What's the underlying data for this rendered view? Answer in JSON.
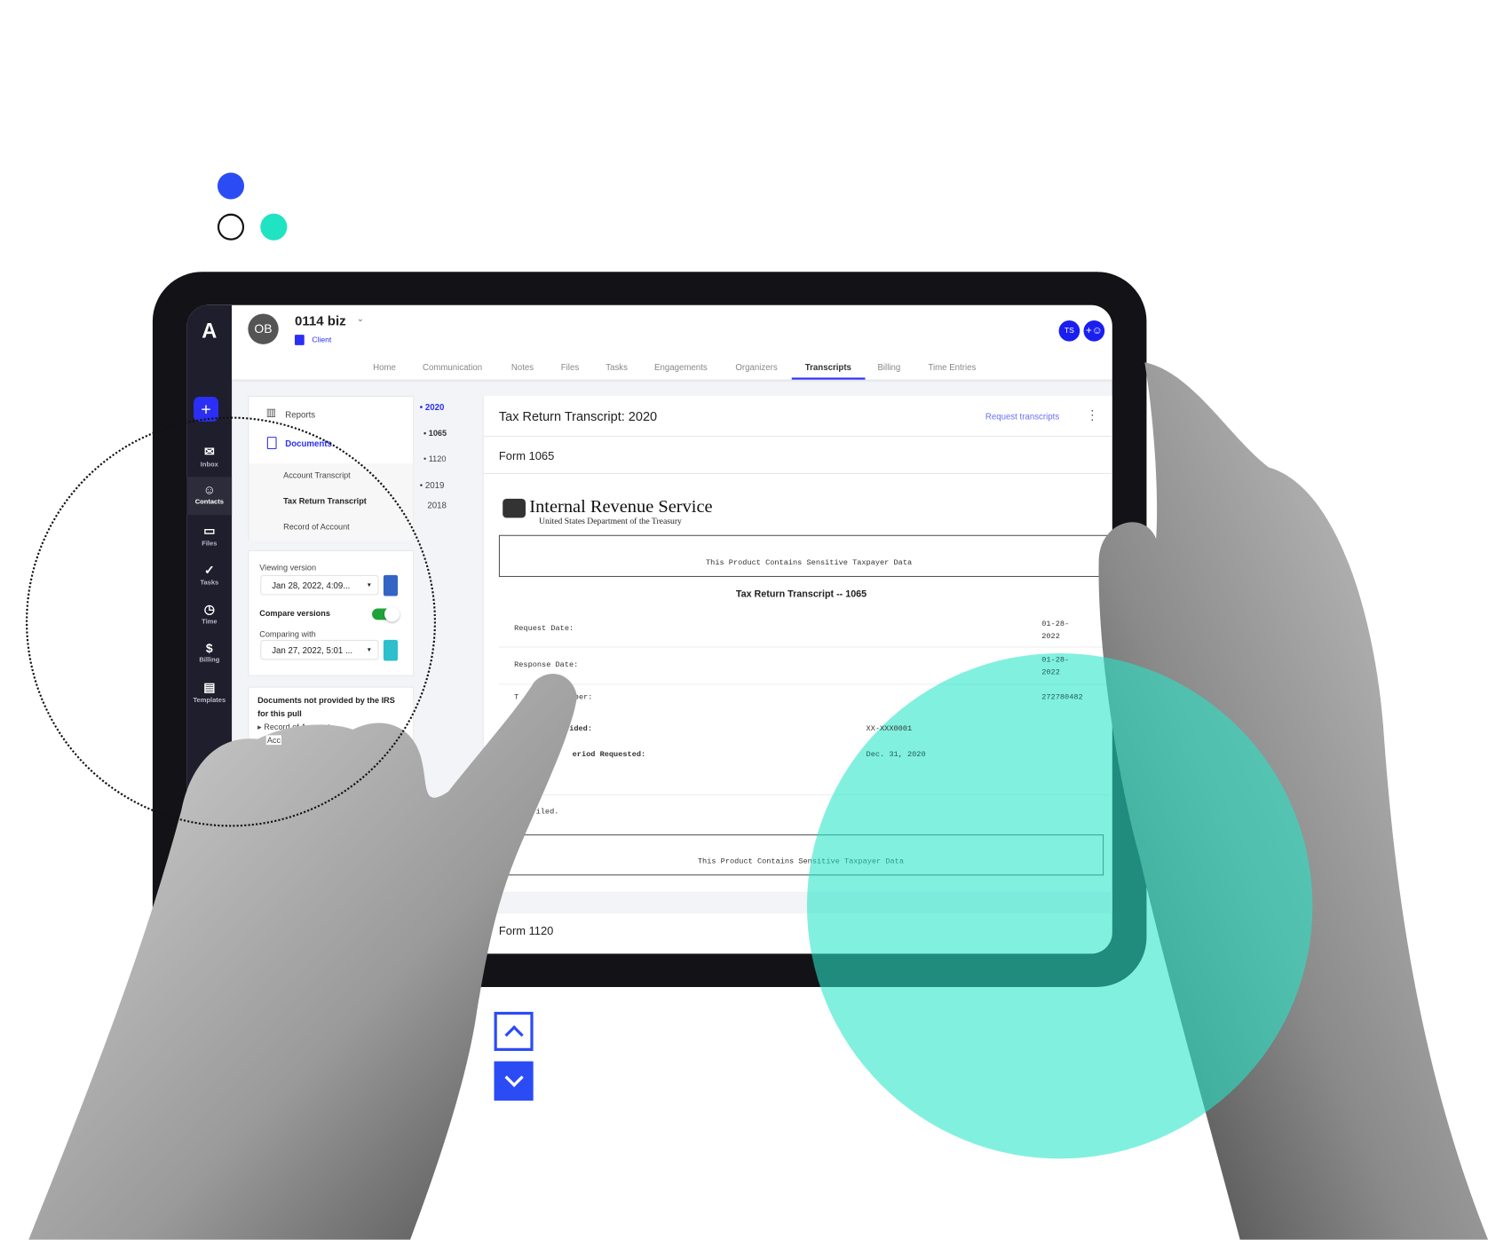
{
  "decor": {
    "accent_blue": "#2b4cf5",
    "teal": "#1fe3c3",
    "dots": [
      "blue-filled",
      "outline",
      "teal-filled"
    ]
  },
  "app": {
    "logo": "A",
    "new_button": "+",
    "nav": [
      {
        "label": "Inbox",
        "icon": "envelope-icon"
      },
      {
        "label": "Contacts",
        "icon": "contacts-icon",
        "active": true
      },
      {
        "label": "Files",
        "icon": "folder-icon"
      },
      {
        "label": "Tasks",
        "icon": "check-circle-icon"
      },
      {
        "label": "Time",
        "icon": "timer-icon"
      },
      {
        "label": "Billing",
        "icon": "dollar-icon"
      },
      {
        "label": "Templates",
        "icon": "templates-icon"
      }
    ],
    "header": {
      "avatar": "OB",
      "title": "0114 biz",
      "type": "Client",
      "user_avatar": "TS",
      "tabs": [
        "Home",
        "Communication",
        "Notes",
        "Files",
        "Tasks",
        "Engagements",
        "Organizers",
        "Transcripts",
        "Billing",
        "Time Entries"
      ],
      "active_tab": "Transcripts"
    },
    "left_panel": {
      "reports": "Reports",
      "documents": "Documents",
      "doc_items": [
        "Account Transcript",
        "Tax Return Transcript",
        "Record of Account"
      ],
      "selected_doc": "Tax Return Transcript",
      "viewing_label": "Viewing version",
      "viewing_value": "Jan 28, 2022, 4:09...",
      "viewing_color": "#3366c4",
      "compare_label": "Compare versions",
      "compare_on": true,
      "comparing_label": "Comparing with",
      "comparing_value": "Jan 27, 2022, 5:01 ...",
      "comparing_color": "#2ebfcc",
      "missing_title": "Documents not provided by the IRS for this pull",
      "missing_items": [
        "Record of Account",
        "Acc"
      ]
    },
    "years": [
      {
        "label": "2020",
        "active": true,
        "dot": true
      },
      {
        "label": "1065",
        "dot": true,
        "sub": true
      },
      {
        "label": "1120",
        "dot": true,
        "sub": true
      },
      {
        "label": "2019",
        "dot": true
      },
      {
        "label": "2018",
        "dot": false
      }
    ],
    "main": {
      "title": "Tax Return Transcript: 2020",
      "request_link": "Request transcripts",
      "form1": "Form 1065",
      "irs_name": "Internal Revenue Service",
      "irs_sub": "United States Department of the Treasury",
      "sensitive": "This Product Contains Sensitive Taxpayer Data",
      "doc_title": "Tax Return Transcript -- 1065",
      "rows": [
        {
          "label": "Request Date:",
          "value": "01-28-\n2022"
        },
        {
          "label": "Response Date:",
          "value": "01-28-\n2022"
        },
        {
          "label": "T",
          "label2": "ber:",
          "value": "272780482"
        },
        {
          "label": "vided:",
          "value": "XX-XXX0001",
          "bold": true
        },
        {
          "label": "eriod Requested:",
          "value": "Dec. 31, 2020",
          "bold": true
        }
      ],
      "filed": "filed.",
      "form2": "Form 1120"
    }
  }
}
